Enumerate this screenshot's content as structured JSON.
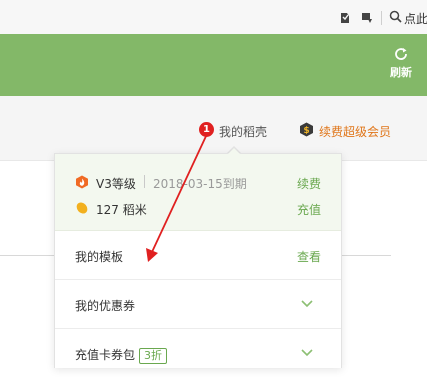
{
  "browser_toolbar": {
    "search_label": "点此"
  },
  "header": {
    "refresh_label": "刷新",
    "accent_color": "#83b868"
  },
  "nav": {
    "notification_count": "1",
    "my_daoke": "我的稻壳",
    "renew_vip": "续费超级会员"
  },
  "dropdown": {
    "level": "V3等级",
    "expire_text": "2018-03-15到期",
    "renew_link": "续费",
    "rice_amount": "127 稻米",
    "recharge_link": "充值",
    "rows": [
      {
        "label": "我的模板",
        "action": "查看"
      },
      {
        "label": "我的优惠券"
      },
      {
        "label": "充值卡券包",
        "badge": "3折"
      }
    ]
  },
  "annotation": {
    "arrow_color": "#e02020"
  }
}
